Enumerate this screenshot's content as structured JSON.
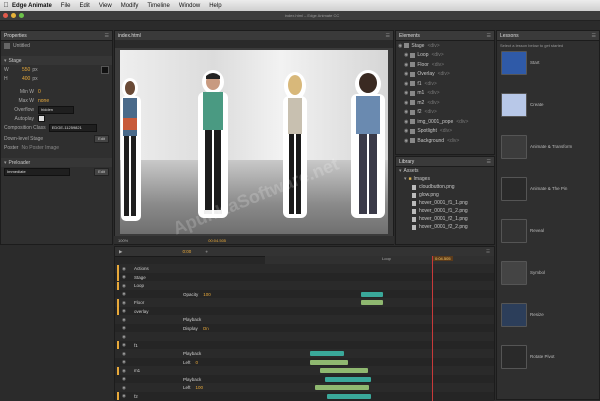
{
  "menubar": {
    "app_name": "Edge Animate",
    "items": [
      "File",
      "Edit",
      "View",
      "Modify",
      "Timeline",
      "Window",
      "Help"
    ]
  },
  "titlebar": {
    "title": "index.html – Edge Animate CC"
  },
  "properties": {
    "tab": "Properties",
    "element_type": "Untitled",
    "section_stage": "Stage",
    "w_label": "W",
    "w_value": "550",
    "w_unit": "px",
    "h_label": "H",
    "h_value": "400",
    "h_unit": "px",
    "min_w_label": "Min W",
    "max_w_label": "Max W",
    "max_w_value": "none",
    "overflow_label": "Overflow",
    "overflow_value": "hidden",
    "autoplay_label": "Autoplay",
    "comp_class_label": "Composition Class",
    "comp_class_value": "EDGE-11259821",
    "down_level_label": "Down-level Stage",
    "down_level_btn": "Edit",
    "poster_label": "Poster",
    "poster_value": "No Poster Image",
    "preloader_section": "Preloader",
    "preloader_value": "Immediate",
    "preloader_btn": "Edit"
  },
  "stage": {
    "tab": "index.html",
    "zoom": "100%",
    "time": "00:04.505"
  },
  "elements": {
    "tab": "Elements",
    "items": [
      {
        "name": "Stage",
        "tag": "<div>"
      },
      {
        "name": "Loop",
        "tag": "<div>"
      },
      {
        "name": "Floor",
        "tag": "<div>"
      },
      {
        "name": "Overlay",
        "tag": "<div>"
      },
      {
        "name": "f1",
        "tag": "<div>"
      },
      {
        "name": "m1",
        "tag": "<div>"
      },
      {
        "name": "m2",
        "tag": "<div>"
      },
      {
        "name": "f2",
        "tag": "<div>"
      },
      {
        "name": "img_0001_pope",
        "tag": "<div>"
      },
      {
        "name": "Spotlight",
        "tag": "<div>"
      },
      {
        "name": "Background",
        "tag": "<div>"
      }
    ]
  },
  "library": {
    "tab": "Library",
    "assets_label": "Assets",
    "images_label": "Images",
    "files": [
      "cloudbutton.png",
      "glow.png",
      "hover_0001_f1_1.png",
      "hover_0001_f1_2.png",
      "hover_0001_f2_1.png",
      "hover_0001_f2_2.png"
    ]
  },
  "lessons": {
    "tab": "Lessons",
    "hint": "Select a lesson below to get started",
    "items": [
      {
        "label": "Start",
        "color": "#2f5aa8"
      },
      {
        "label": "Create",
        "color": "#b8c8e8"
      },
      {
        "label": "Animate & Transform",
        "color": "#3c3c3c"
      },
      {
        "label": "Animate & The Pin",
        "color": "#2a2a2a"
      },
      {
        "label": "Reveal",
        "color": "#333333"
      },
      {
        "label": "Symbol",
        "color": "#444444"
      },
      {
        "label": "Resize",
        "color": "#2c3e5a"
      },
      {
        "label": "Rotate Pivot",
        "color": "#2a2a2a"
      }
    ]
  },
  "timeline": {
    "time": "0:00",
    "playhead_time": "0:04.505",
    "end_label": "Loop",
    "action_label": "Actions",
    "rows": [
      {
        "label": "Actions",
        "indent": 1,
        "prop": "",
        "val": ""
      },
      {
        "label": "Stage",
        "indent": 1,
        "prop": "",
        "val": ""
      },
      {
        "label": "Loop",
        "indent": 1,
        "prop": "",
        "val": ""
      },
      {
        "label": "",
        "indent": 2,
        "prop": "Opacity",
        "val": "100"
      },
      {
        "label": "Floor",
        "indent": 1,
        "prop": "",
        "val": ""
      },
      {
        "label": "overlay",
        "indent": 1,
        "prop": "",
        "val": ""
      },
      {
        "label": "",
        "indent": 2,
        "prop": "Playback",
        "val": ""
      },
      {
        "label": "",
        "indent": 2,
        "prop": "Display",
        "val": "On"
      },
      {
        "label": "",
        "indent": 2,
        "prop": "",
        "val": ""
      },
      {
        "label": "f1",
        "indent": 1,
        "prop": "",
        "val": ""
      },
      {
        "label": "",
        "indent": 2,
        "prop": "Playback",
        "val": ""
      },
      {
        "label": "",
        "indent": 2,
        "prop": "Left",
        "val": "0"
      },
      {
        "label": "m1",
        "indent": 1,
        "prop": "",
        "val": ""
      },
      {
        "label": "",
        "indent": 2,
        "prop": "Playback",
        "val": ""
      },
      {
        "label": "",
        "indent": 2,
        "prop": "Left",
        "val": "100"
      },
      {
        "label": "f2",
        "indent": 1,
        "prop": "",
        "val": ""
      }
    ]
  },
  "watermark": "ApunKaSoftware.net",
  "colors": {
    "accent": "#e8a93a",
    "teal_bar": "#3aa89a",
    "green_bar": "#8fb870",
    "playhead": "#c83a3a"
  }
}
